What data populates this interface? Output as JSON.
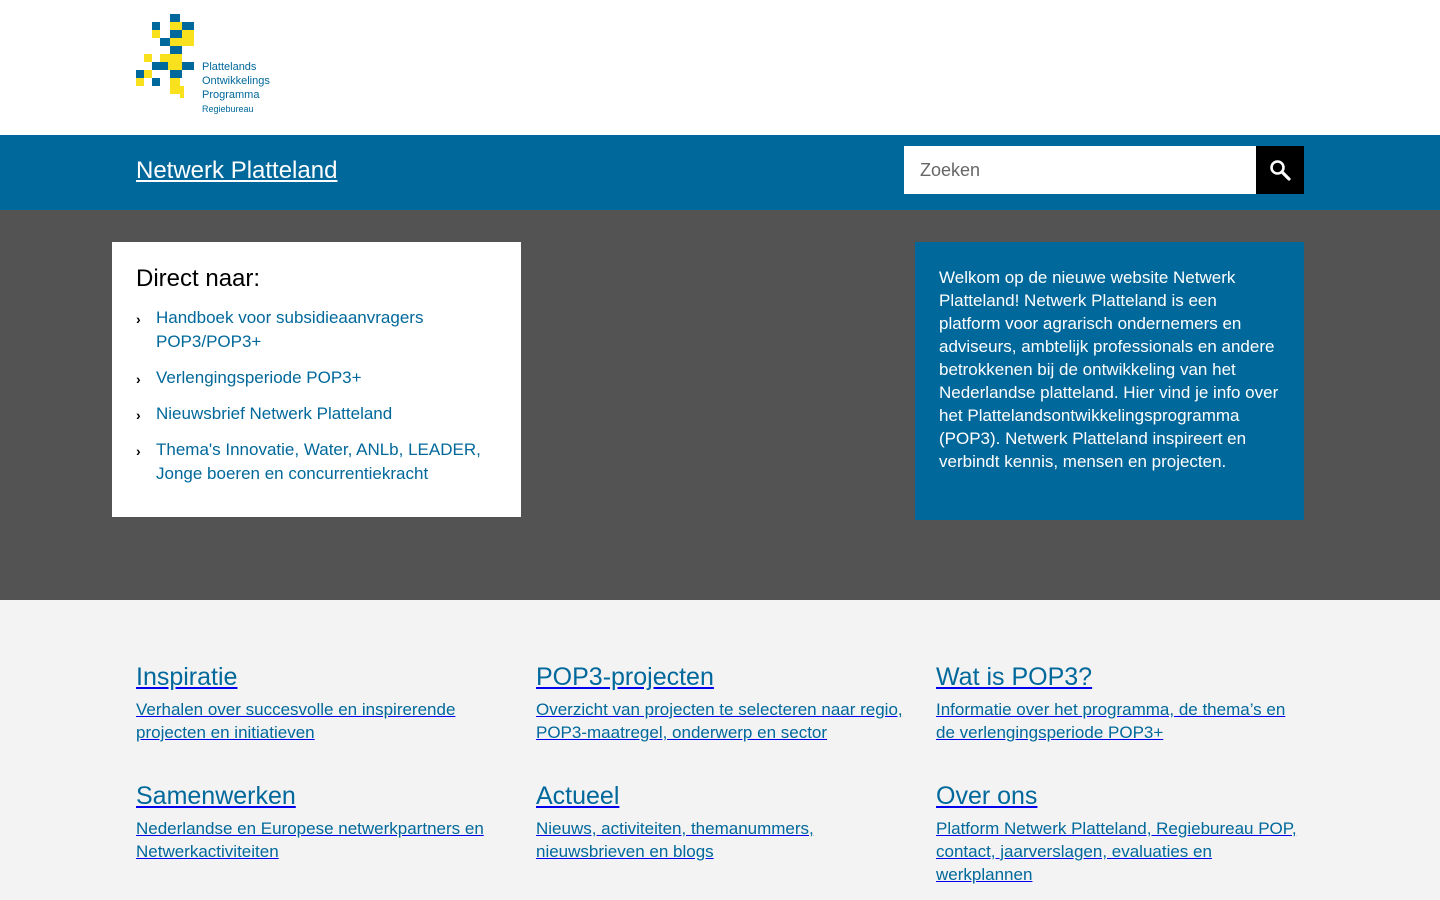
{
  "logo": {
    "line1": "Plattelands",
    "line2": "Ontwikkelings",
    "line3": "Programma",
    "line4": "Regiebureau",
    "colors": {
      "blue": "#01689b",
      "yellow": "#f9e11e"
    }
  },
  "header": {
    "site_title": "Netwerk Platteland",
    "search_placeholder": "Zoeken",
    "search_icon": "search-icon"
  },
  "direct": {
    "title": "Direct naar:",
    "links": [
      {
        "label": "Handboek voor subsidieaanvragers POP3/POP3+"
      },
      {
        "label": "Verlengingsperiode POP3+"
      },
      {
        "label": "Nieuwsbrief Netwerk Platteland"
      },
      {
        "label": "Thema's Innovatie, Water, ANLb, LEADER, Jonge boeren en concurrentiekracht"
      }
    ]
  },
  "welcome": {
    "text": "Welkom op de nieuwe website Netwerk Platteland! Netwerk Platteland is een platform voor agrarisch ondernemers en adviseurs, ambtelijk professionals en andere betrokkenen bij de ontwikkeling van het Nederlandse platteland. Hier vind je info over het Plattelandsontwikkelingsprogramma (POP3). Netwerk Platteland inspireert en verbindt kennis, mensen en projecten."
  },
  "sections": [
    {
      "title": "Inspiratie",
      "text": "Verhalen over succesvolle en inspirerende projecten en initiatieven"
    },
    {
      "title": "POP3-projecten",
      "text": "Overzicht van projecten te selecteren naar regio, POP3-maatregel, onderwerp en sector"
    },
    {
      "title": "Wat is POP3?",
      "text": "Informatie over het programma, de thema’s en de verlengingsperiode POP3+"
    },
    {
      "title": "Samenwerken",
      "text": "Nederlandse en Europese netwerkpartners en Netwerkactiviteiten"
    },
    {
      "title": "Actueel",
      "text": "Nieuws, activiteiten, themanummers, nieuwsbrieven en blogs"
    },
    {
      "title": "Over ons",
      "text": "Platform Netwerk Platteland, Regiebureau POP, contact, jaarverslagen, evaluaties en werkplannen"
    }
  ]
}
